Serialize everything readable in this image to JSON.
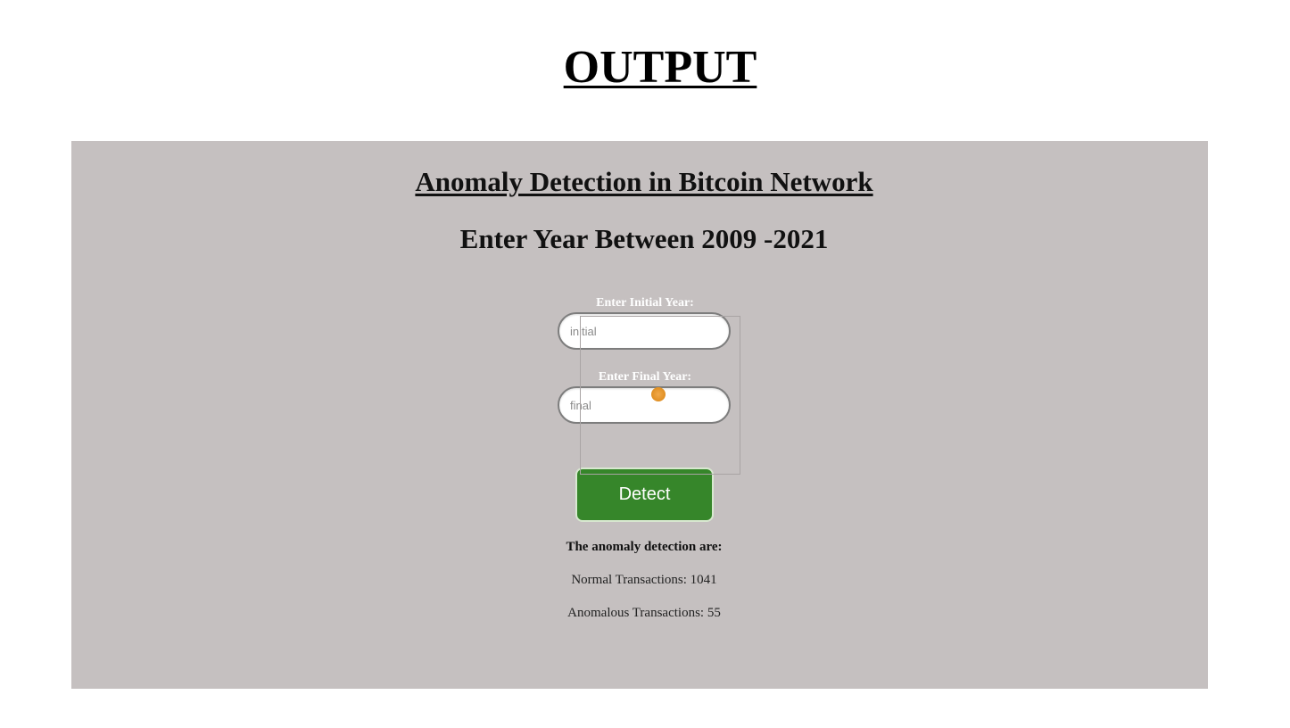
{
  "page": {
    "heading": "OUTPUT"
  },
  "app": {
    "title": "Anomaly Detection in Bitcoin Network",
    "subtitle": "Enter Year Between 2009 -2021",
    "form": {
      "initial_label": "Enter Initial Year:",
      "initial_placeholder": "initial",
      "initial_value": "",
      "final_label": "Enter Final Year:",
      "final_placeholder": "final",
      "final_value": "",
      "submit_label": "Detect"
    },
    "results": {
      "heading": "The anomaly detection are:",
      "normal": "Normal Transactions: 1041",
      "anomalous": "Anomalous Transactions: 55"
    }
  },
  "colors": {
    "panel_background": "#c5c0c0",
    "button_background": "#36862a",
    "cursor_indicator": "#e08f22"
  }
}
